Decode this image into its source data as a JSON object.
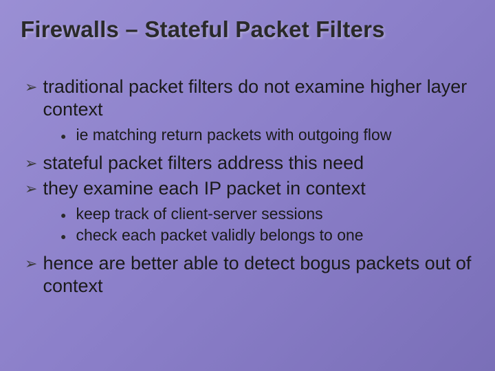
{
  "slide": {
    "title": "Firewalls – Stateful Packet Filters",
    "bullets": [
      {
        "text": "traditional packet filters do not examine higher layer context",
        "sub": [
          {
            "text": "ie matching return packets with outgoing flow"
          }
        ]
      },
      {
        "text": "stateful packet filters address this need",
        "sub": []
      },
      {
        "text": "they examine each IP packet in context",
        "sub": [
          {
            "text": "keep track of client-server sessions"
          },
          {
            "text": "check each packet validly belongs to one"
          }
        ]
      },
      {
        "text": "hence are better able to detect bogus packets out of context",
        "sub": []
      }
    ]
  }
}
